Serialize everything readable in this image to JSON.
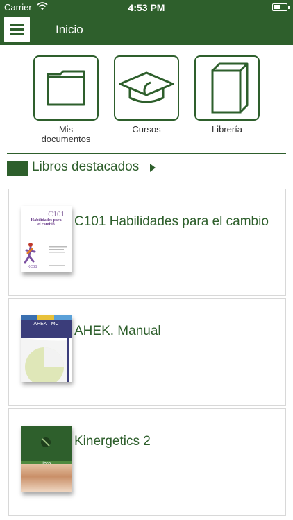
{
  "status": {
    "carrier": "Carrier",
    "time": "4:53 PM"
  },
  "nav": {
    "title": "Inicio"
  },
  "shortcuts": [
    {
      "label": "Mis documentos",
      "icon": "folder-icon"
    },
    {
      "label": "Cursos",
      "icon": "graduation-cap-icon"
    },
    {
      "label": "Librería",
      "icon": "book-icon"
    }
  ],
  "featured": {
    "title": "Libros destacados"
  },
  "books": [
    {
      "title": "C101 Habilidades para el cambio",
      "cover_code": "C101",
      "cover_line1": "Habilidades para",
      "cover_line2": "el cambio",
      "cover_brand": "KCBS"
    },
    {
      "title": "AHEK. Manual",
      "cover_code": "AHEK · MC"
    },
    {
      "title": "Kinergetics 2",
      "cover_band": "libro"
    }
  ],
  "colors": {
    "primary": "#2e5f2c"
  }
}
